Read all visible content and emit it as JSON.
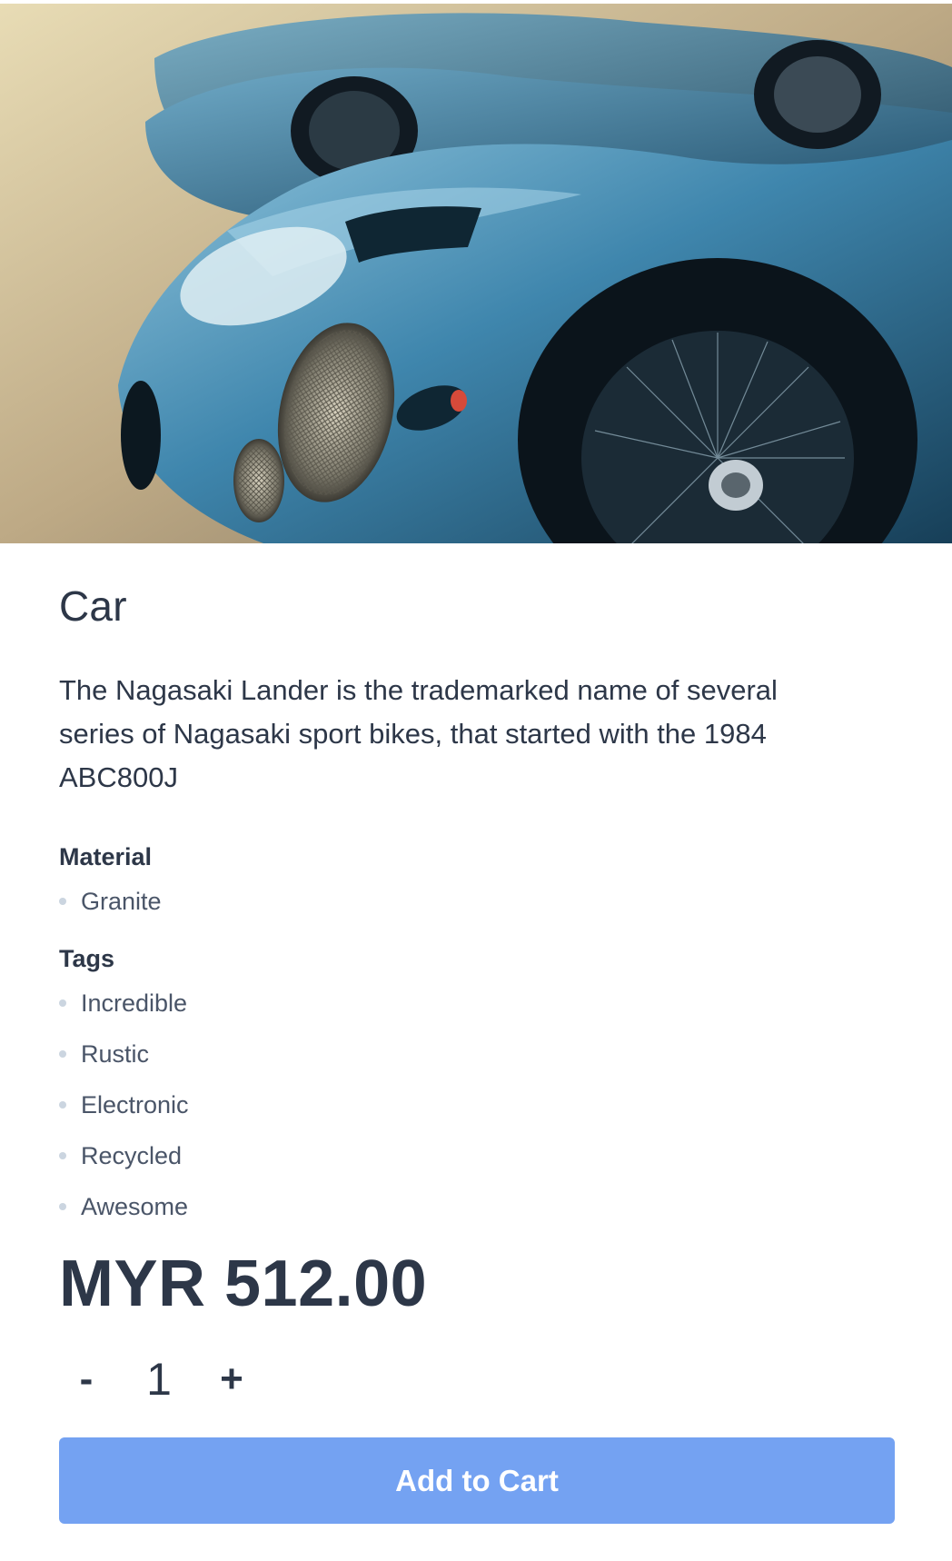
{
  "product": {
    "image_alt": "Car",
    "title": "Car",
    "description": "The Nagasaki Lander is the trademarked name of several series of Nagasaki sport bikes, that started with the 1984 ABC800J",
    "material_heading": "Material",
    "materials": [
      "Granite"
    ],
    "tags_heading": "Tags",
    "tags": [
      "Incredible",
      "Rustic",
      "Electronic",
      "Recycled",
      "Awesome"
    ],
    "price": "MYR 512.00"
  },
  "quantity": {
    "decrement_label": "-",
    "value": "1",
    "increment_label": "+"
  },
  "actions": {
    "add_to_cart_label": "Add to Cart"
  },
  "colors": {
    "accent": "#74a2f2",
    "text": "#2d3748",
    "bullet": "#cbd5e0"
  }
}
